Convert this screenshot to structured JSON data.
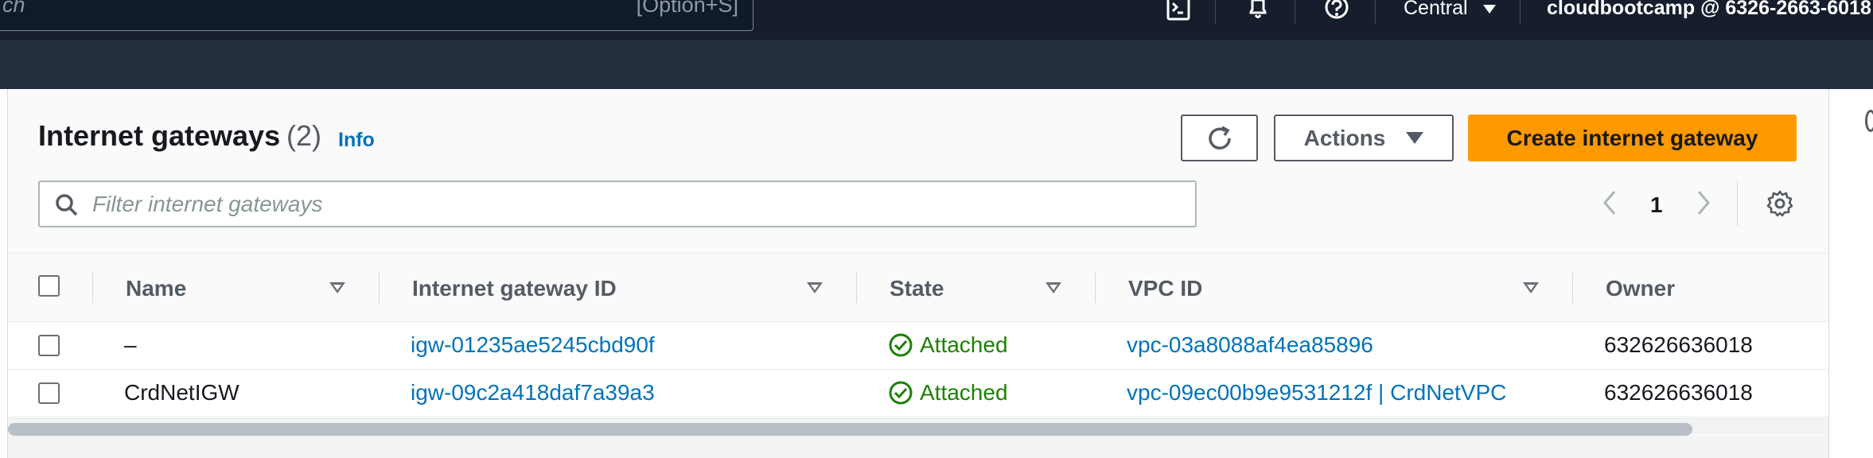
{
  "topbar": {
    "search_placeholder": "ch",
    "search_shortcut": "[Option+S]",
    "region": "Central",
    "account": "cloudbootcamp @ 6326-2663-6018"
  },
  "page": {
    "title": "Internet gateways",
    "count": "(2)",
    "info": "Info"
  },
  "toolbar": {
    "actions_label": "Actions",
    "create_label": "Create internet gateway"
  },
  "filter": {
    "placeholder": "Filter internet gateways",
    "value": ""
  },
  "pagination": {
    "current_page": "1"
  },
  "table": {
    "columns": [
      "Name",
      "Internet gateway ID",
      "State",
      "VPC ID",
      "Owner"
    ],
    "rows": [
      {
        "name": "–",
        "gateway_id": "igw-01235ae5245cbd90f",
        "state": "Attached",
        "vpc_id": "vpc-03a8088af4ea85896",
        "owner": "632626636018"
      },
      {
        "name": "CrdNetIGW",
        "gateway_id": "igw-09c2a418daf7a39a3",
        "state": "Attached",
        "vpc_id": "vpc-09ec00b9e9531212f | CrdNetVPC",
        "owner": "632626636018"
      }
    ]
  },
  "colors": {
    "topbar_bg": "#232f3e",
    "primary_orange": "#ff9900",
    "link_blue": "#0073bb",
    "success_green": "#1d8102"
  }
}
